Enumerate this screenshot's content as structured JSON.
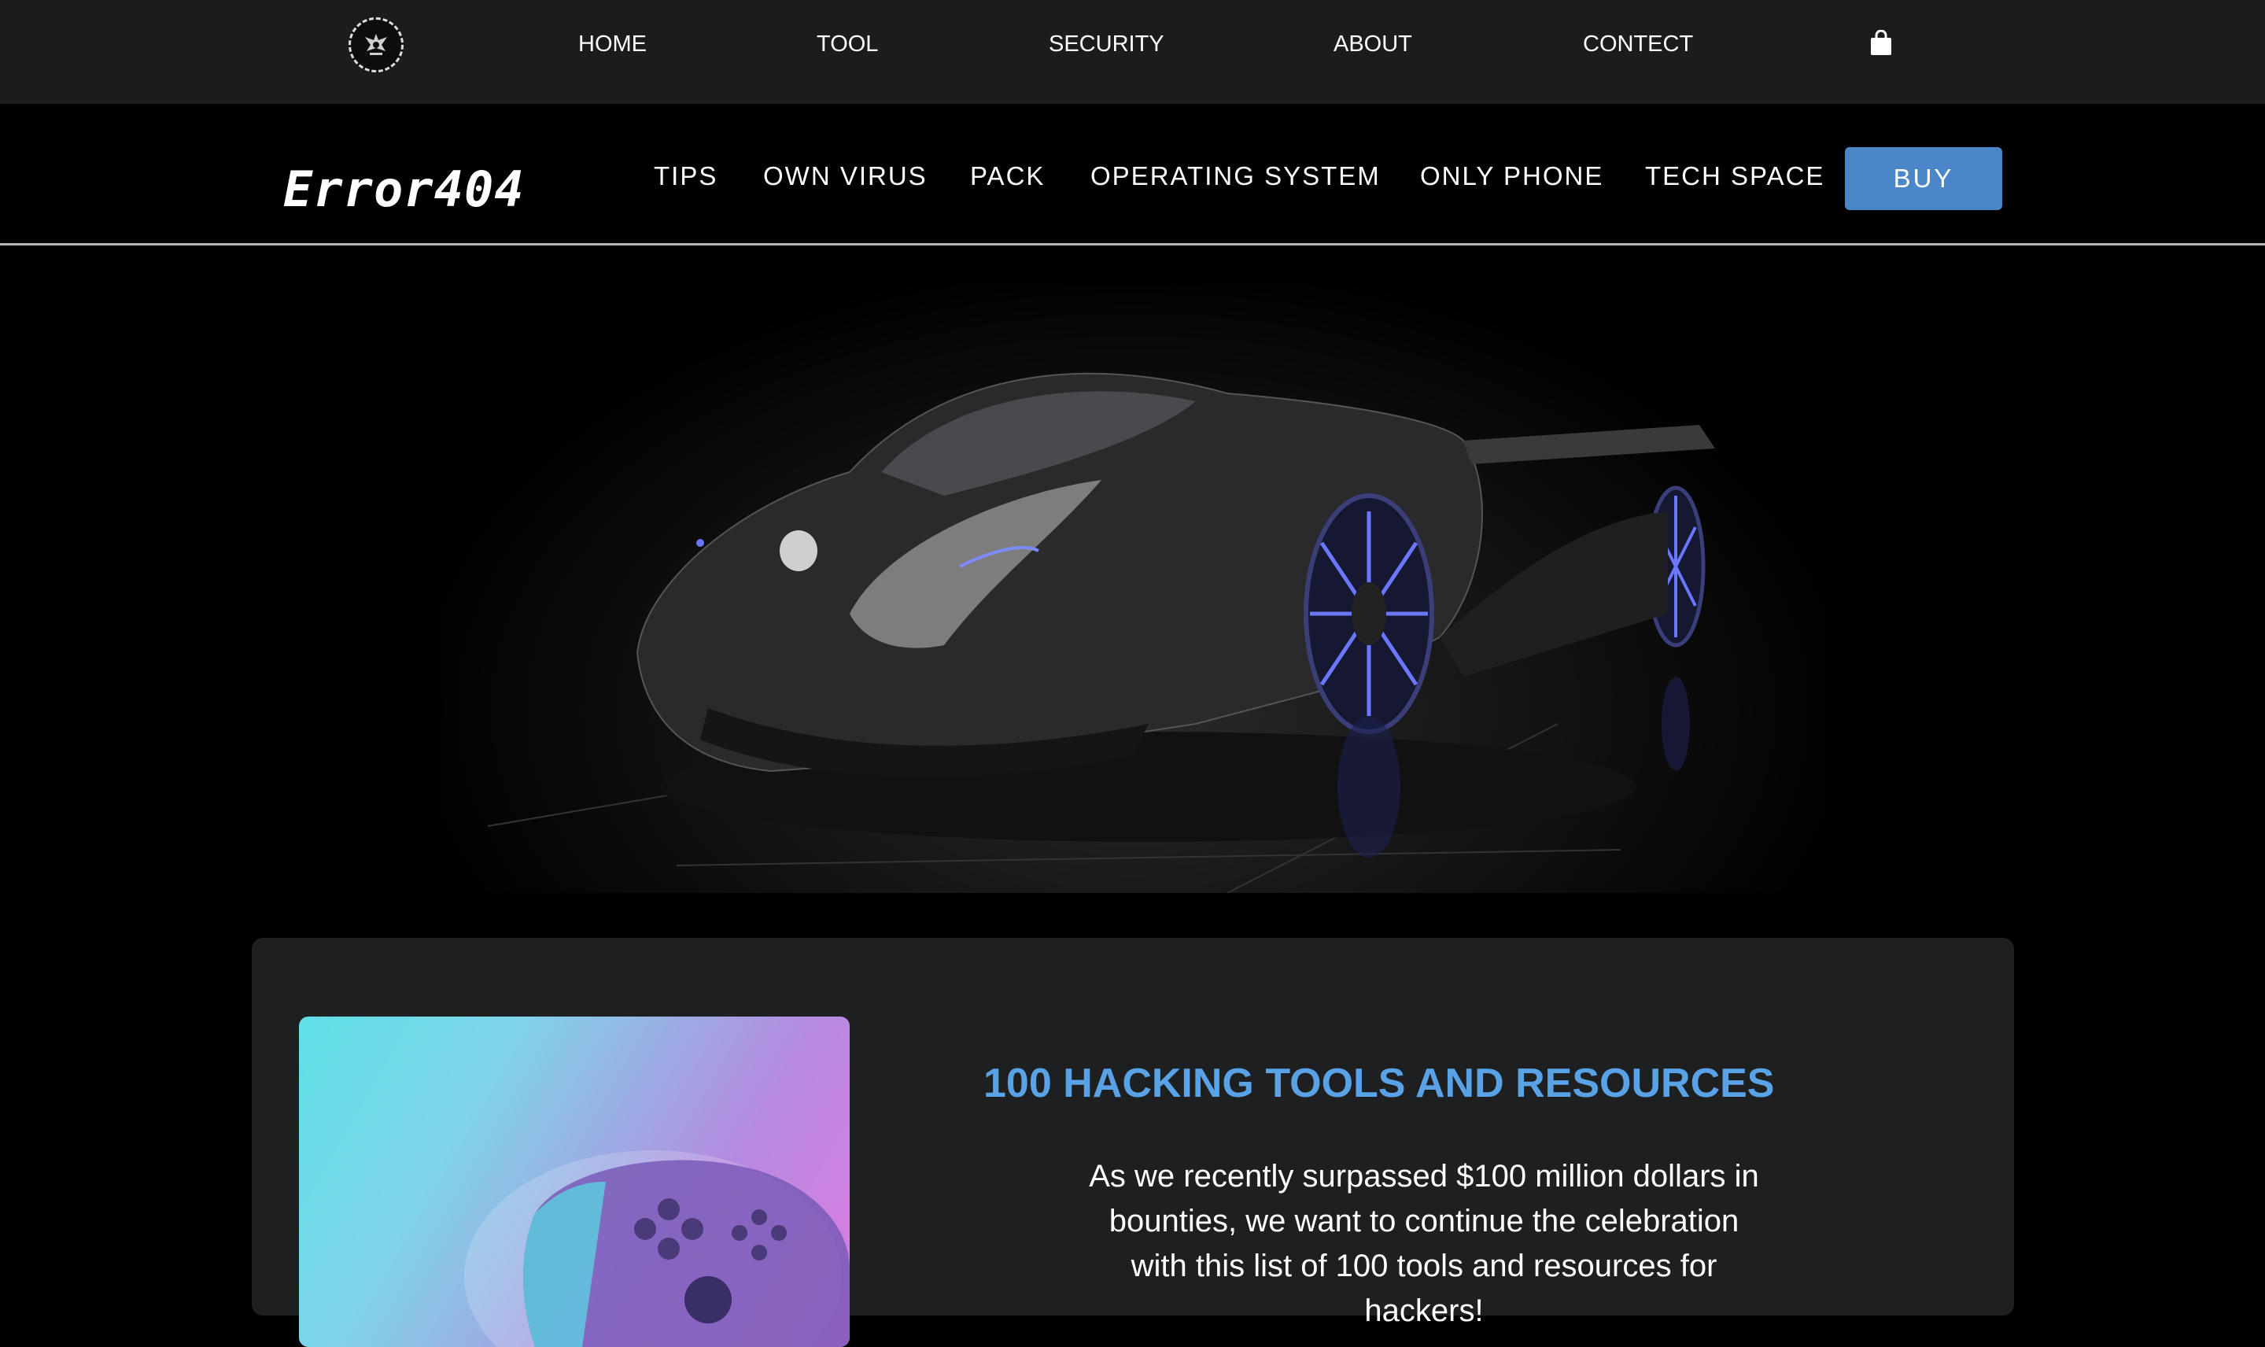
{
  "top_nav": {
    "logo_icon": "eagle-emblem-icon",
    "items": [
      "HOME",
      "TOOL",
      "SECURITY",
      "ABOUT",
      "CONTECT"
    ],
    "cart_icon": "shopping-bag-icon"
  },
  "header": {
    "brand": "Error404",
    "items": [
      "TIPS",
      "OWN VIRUS",
      "PACK",
      "OPERATING SYSTEM",
      "ONLY PHONE",
      "TECH SPACE"
    ],
    "buy_label": "BUY",
    "buy_color": "#4a86c8"
  },
  "hero": {
    "image": "black-supercar-image"
  },
  "card": {
    "image": "game-controller-image",
    "title": "100 HACKING TOOLS AND RESOURCES",
    "title_color": "#5aa2e6",
    "text": "As we recently surpassed $100 million dollars in bounties, we want to continue the celebration with this list of 100 tools and resources for hackers!"
  }
}
